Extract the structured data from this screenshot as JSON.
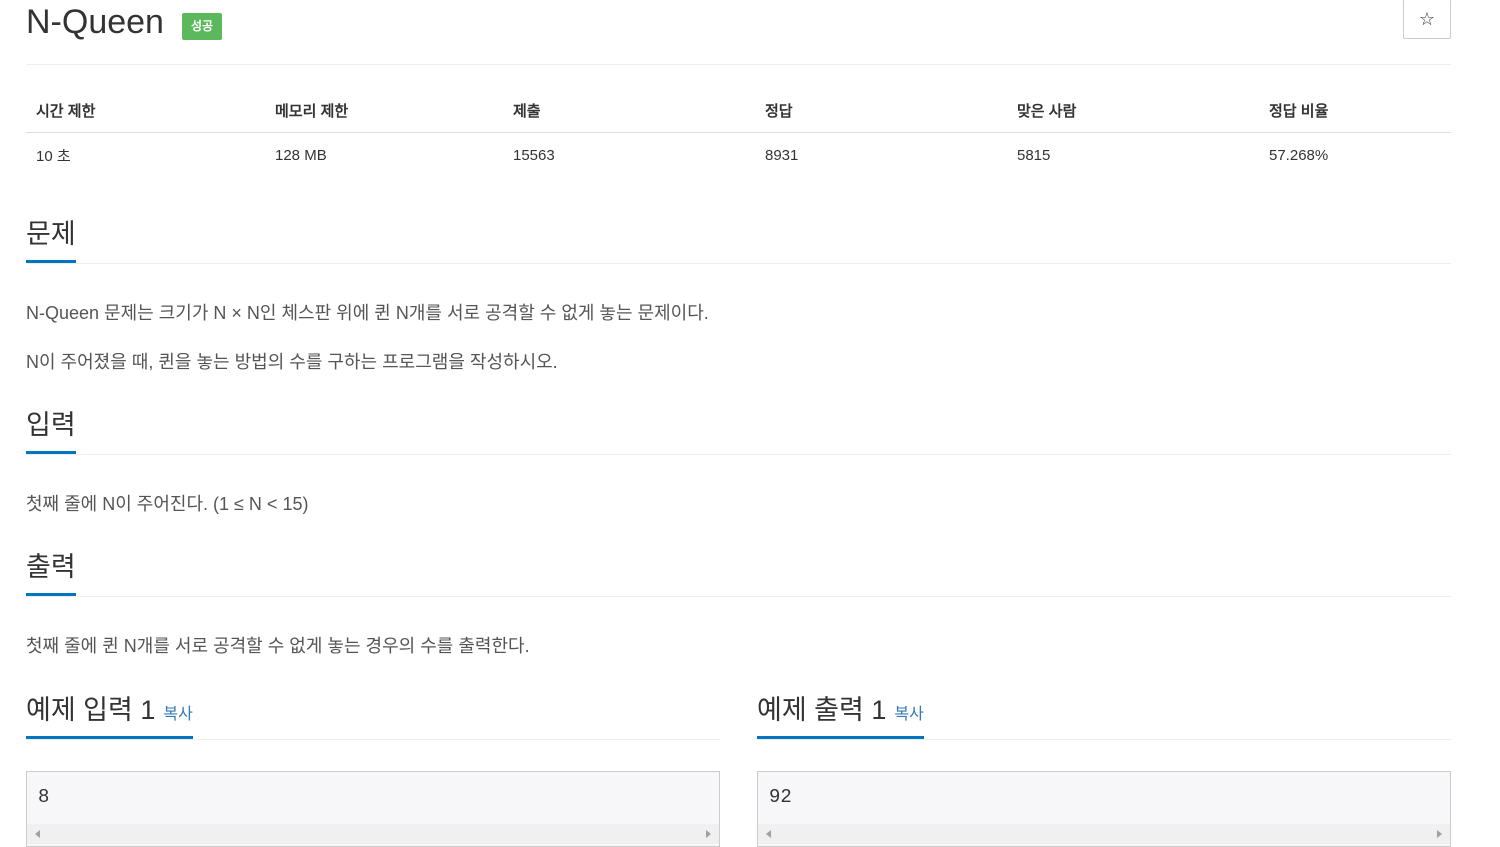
{
  "problem": {
    "title": "N-Queen",
    "status_badge": "성공",
    "star_icon": "☆"
  },
  "info_table": {
    "headers": [
      "시간 제한",
      "메모리 제한",
      "제출",
      "정답",
      "맞은 사람",
      "정답 비율"
    ],
    "values": [
      "10 초",
      "128 MB",
      "15563",
      "8931",
      "5815",
      "57.268%"
    ]
  },
  "sections": {
    "description": {
      "heading": "문제",
      "paragraphs": [
        "N-Queen 문제는 크기가 N × N인 체스판 위에 퀸 N개를 서로 공격할 수 없게 놓는 문제이다.",
        "N이 주어졌을 때, 퀸을 놓는 방법의 수를 구하는 프로그램을 작성하시오."
      ]
    },
    "input": {
      "heading": "입력",
      "text": "첫째 줄에 N이 주어진다. (1 ≤ N < 15)"
    },
    "output": {
      "heading": "출력",
      "text": "첫째 줄에 퀸 N개를 서로 공격할 수 없게 놓는 경우의 수를 출력한다."
    }
  },
  "samples": {
    "input": {
      "heading": "예제 입력 1",
      "copy_label": "복사",
      "content": "8"
    },
    "output": {
      "heading": "예제 출력 1",
      "copy_label": "복사",
      "content": "92"
    }
  },
  "colors": {
    "accent_underline": "#0076c0",
    "success_badge": "#5cb85c",
    "link": "#337ab7"
  }
}
